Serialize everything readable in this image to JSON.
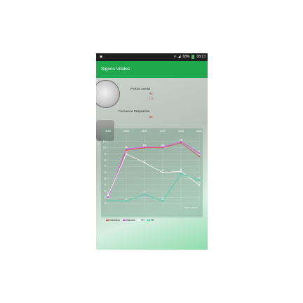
{
  "status_bar": {
    "battery": "68%",
    "time": "08:13"
  },
  "app_bar": {
    "title": "Signos Vitales"
  },
  "cards": {
    "pressure_label": "Presion arterial",
    "pressure_diastolic": "90",
    "pressure_systolic": "118",
    "resp_label": "Frecuencia Respiratoria",
    "resp_value": "25"
  },
  "chart_data": {
    "type": "line",
    "categories": [
      "01/00",
      "01/00",
      "01/00",
      "01/00",
      "01/00",
      "02/00"
    ],
    "y_ticks": [
      "110",
      "100",
      "90",
      "80",
      "70",
      "60",
      "50",
      "40",
      "30",
      "20",
      "10"
    ],
    "watermark": "Signos Vitales",
    "colors": {
      "Diastólica": "#e74c3c",
      "Sistolica": "#e74cff",
      "FC": "#ffffff",
      "FR": "#3fd2b0"
    },
    "series": [
      {
        "name": "Diastólica",
        "values": [
          20,
          96,
          100,
          100,
          108,
          86
        ]
      },
      {
        "name": "Sistolica",
        "values": [
          20,
          98,
          101,
          101,
          110,
          91
        ]
      },
      {
        "name": "FC",
        "values": [
          23,
          90,
          76,
          60,
          62,
          40
        ]
      },
      {
        "name": "FR",
        "values": [
          15,
          14,
          25,
          14,
          58,
          48
        ]
      }
    ]
  }
}
